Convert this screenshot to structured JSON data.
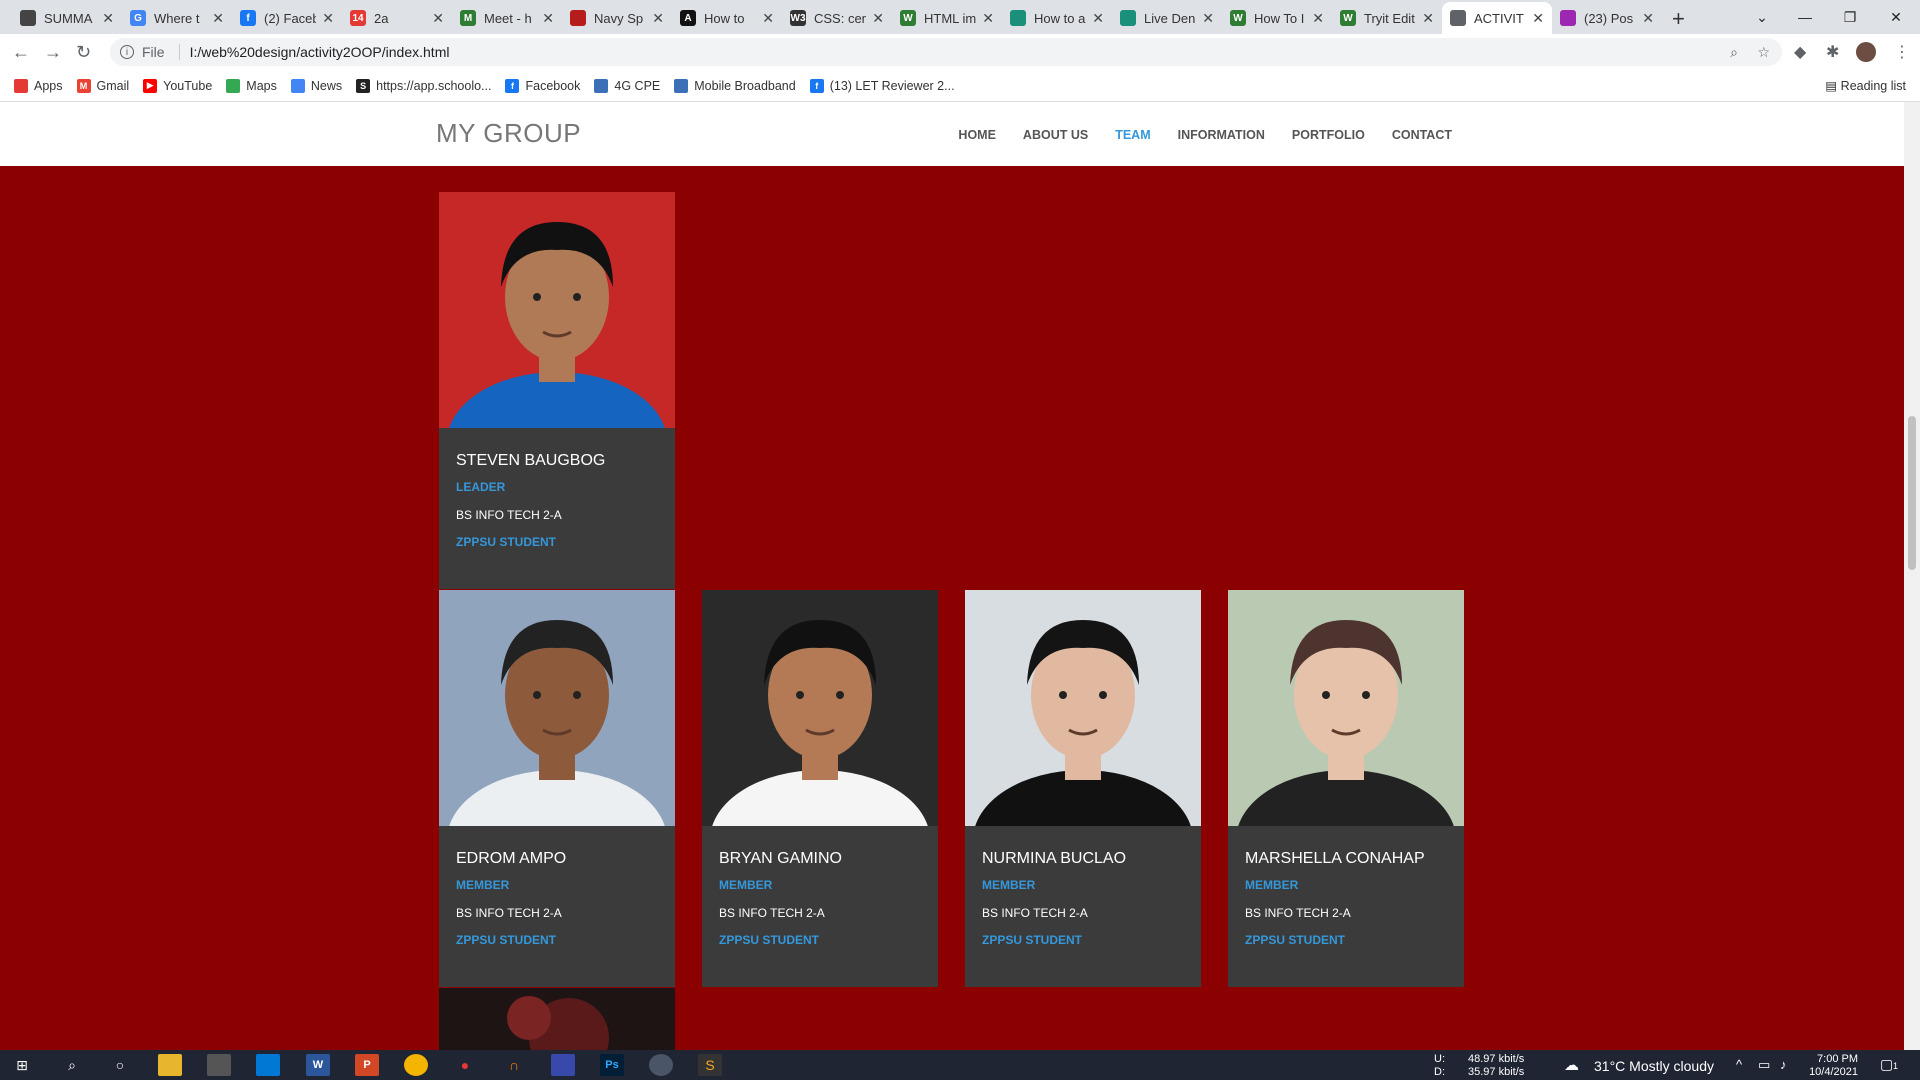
{
  "browser": {
    "tabs": [
      {
        "title": "SUMMA",
        "color": "#444"
      },
      {
        "title": "Where t",
        "color": "#4285f4",
        "glyph": "G"
      },
      {
        "title": "(2) Faceb",
        "color": "#1877f2",
        "glyph": "f"
      },
      {
        "title": "2a",
        "color": "#e53935",
        "glyph": "14"
      },
      {
        "title": "Meet - h",
        "color": "#2e7d32",
        "glyph": "M"
      },
      {
        "title": "Navy Sp",
        "color": "#b71c1c"
      },
      {
        "title": "How to",
        "color": "#111",
        "glyph": "A"
      },
      {
        "title": "CSS: cen",
        "color": "#333",
        "glyph": "W3"
      },
      {
        "title": "HTML im",
        "color": "#2e7d32",
        "glyph": "W"
      },
      {
        "title": "How to a",
        "color": "#1a8f7a"
      },
      {
        "title": "Live Den",
        "color": "#1a8f7a"
      },
      {
        "title": "How To I",
        "color": "#2e7d32",
        "glyph": "W"
      },
      {
        "title": "Tryit Edit",
        "color": "#2e7d32",
        "glyph": "W"
      },
      {
        "title": "ACTIVIT",
        "color": "#5f6368",
        "active": true
      },
      {
        "title": "(23) Pos",
        "color": "#9c27b0"
      }
    ],
    "url": "I:/web%20design/activity2OOP/index.html",
    "url_label": "File",
    "bookmarks": [
      {
        "label": "Apps",
        "color": "#e53935"
      },
      {
        "label": "Gmail",
        "color": "#ea4335",
        "glyph": "M"
      },
      {
        "label": "YouTube",
        "color": "#ff0000",
        "glyph": "▶"
      },
      {
        "label": "Maps",
        "color": "#34a853"
      },
      {
        "label": "News",
        "color": "#4285f4"
      },
      {
        "label": "https://app.schoolo...",
        "color": "#222",
        "glyph": "S"
      },
      {
        "label": "Facebook",
        "color": "#1877f2",
        "glyph": "f"
      },
      {
        "label": "4G CPE",
        "color": "#3b6fb6"
      },
      {
        "label": "Mobile Broadband",
        "color": "#3b6fb6"
      },
      {
        "label": "(13) LET Reviewer 2...",
        "color": "#1877f2",
        "glyph": "f"
      }
    ],
    "reading_list": "Reading list"
  },
  "site": {
    "brand": "MY GROUP",
    "menu": [
      "HOME",
      "ABOUT US",
      "TEAM",
      "INFORMATION",
      "PORTFOLIO",
      "CONTACT"
    ],
    "active_menu": "TEAM",
    "members": [
      {
        "name": "STEVEN BAUGBOG",
        "role": "LEADER",
        "course": "BS INFO TECH 2-A",
        "school": "ZPPSU STUDENT"
      },
      {
        "name": "EDROM AMPO",
        "role": "MEMBER",
        "course": "BS INFO TECH 2-A",
        "school": "ZPPSU STUDENT"
      },
      {
        "name": "BRYAN GAMINO",
        "role": "MEMBER",
        "course": "BS INFO TECH 2-A",
        "school": "ZPPSU STUDENT"
      },
      {
        "name": "NURMINA BUCLAO",
        "role": "MEMBER",
        "course": "BS INFO TECH 2-A",
        "school": "ZPPSU STUDENT"
      },
      {
        "name": "MARSHELLA CONAHAP",
        "role": "MEMBER",
        "course": "BS INFO TECH 2-A",
        "school": "ZPPSU STUDENT"
      }
    ]
  },
  "taskbar": {
    "net_up_label": "U:",
    "net_down_label": "D:",
    "net_up": "48.97 kbit/s",
    "net_down": "35.97 kbit/s",
    "weather": "31°C  Mostly cloudy",
    "time": "7:00 PM",
    "date": "10/4/2021",
    "notif_count": "1"
  }
}
